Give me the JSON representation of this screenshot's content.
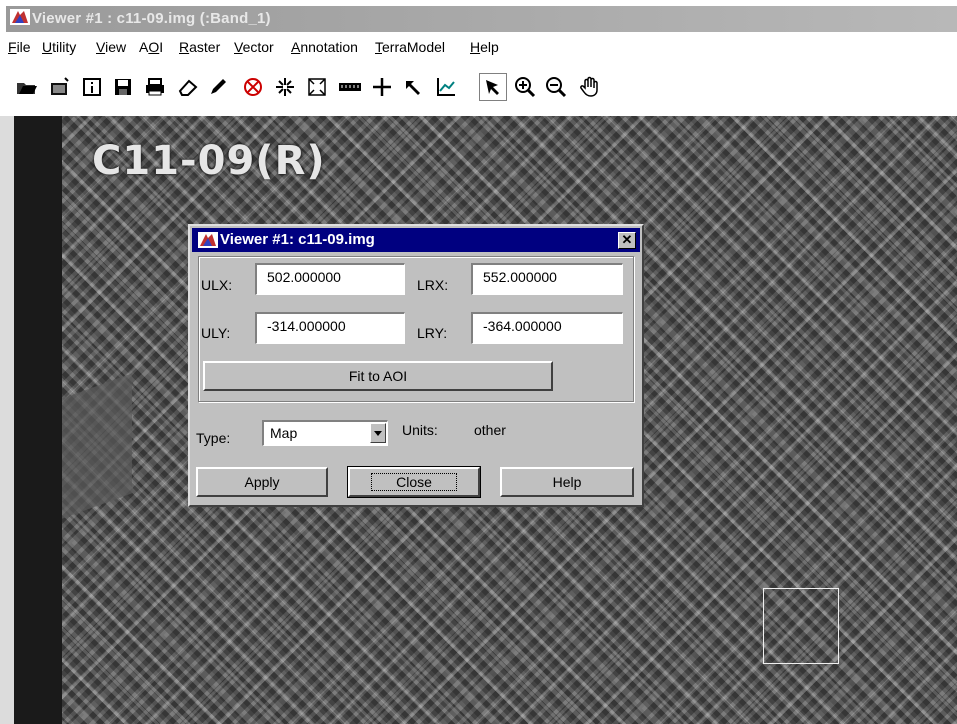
{
  "window": {
    "title": "Viewer #1 : c11-09.img (:Band_1)"
  },
  "menu": [
    {
      "label": "File",
      "key": "F"
    },
    {
      "label": "Utility",
      "key": "U"
    },
    {
      "label": "View",
      "key": "V"
    },
    {
      "label": "AOI",
      "key": "O"
    },
    {
      "label": "Raster",
      "key": "R"
    },
    {
      "label": "Vector",
      "key": "V"
    },
    {
      "label": "Annotation",
      "key": "A"
    },
    {
      "label": "TerraModel",
      "key": "T"
    },
    {
      "label": "Help",
      "key": "H"
    }
  ],
  "toolbar": {
    "tools": [
      "open-folder-icon",
      "new-viewer-icon",
      "info-icon",
      "save-icon",
      "print-icon",
      "eraser-icon",
      "pencil-icon",
      "measure-target-icon",
      "zoom-extent-icon",
      "fit-frame-icon",
      "ruler-icon",
      "crosshair-icon",
      "pick-icon",
      "profile-icon",
      "select-arrow-icon",
      "zoom-in-icon",
      "zoom-out-icon",
      "pan-hand-icon"
    ]
  },
  "image": {
    "overlay_label": "C11-09(R)"
  },
  "dialog": {
    "title": "Viewer #1: c11-09.img",
    "ulx_label": "ULX:",
    "ulx_value": "502.000000",
    "lrx_label": "LRX:",
    "lrx_value": "552.000000",
    "uly_label": "ULY:",
    "uly_value": "-314.000000",
    "lry_label": "LRY:",
    "lry_value": "-364.000000",
    "fit_button": "Fit to AOI",
    "type_label": "Type:",
    "type_value": "Map",
    "units_label": "Units:",
    "units_value": "other",
    "apply_button": "Apply",
    "close_button": "Close",
    "help_button": "Help",
    "close_glyph": "✕"
  },
  "colors": {
    "dialog_title_bg": "#000080",
    "window_bg": "#c0c0c0"
  }
}
